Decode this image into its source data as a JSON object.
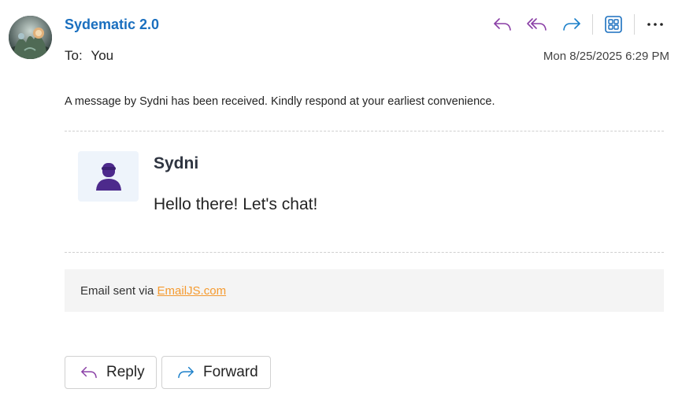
{
  "header": {
    "sender": "Sydematic 2.0",
    "to_label": "To:",
    "to_value": "You",
    "timestamp": "Mon 8/25/2025 6:29 PM"
  },
  "toolbar": {
    "icons": [
      "reply-icon",
      "reply-all-icon",
      "forward-icon",
      "apps-icon",
      "more-icon"
    ]
  },
  "body": {
    "intro": "A message by Sydni has been received. Kindly respond at your earliest convenience.",
    "message": {
      "author": "Sydni",
      "text": "Hello there! Let's chat!"
    },
    "footer": {
      "prefix": "Email sent via",
      "link_text": "EmailJS.com"
    }
  },
  "actions": {
    "reply_label": "Reply",
    "forward_label": "Forward"
  },
  "colors": {
    "sender": "#1a6fbf",
    "reply_purple": "#8a3fa6",
    "forward_blue": "#1a7fc9",
    "link_orange": "#f59a2f",
    "avatar_purple": "#4d2a8c"
  }
}
